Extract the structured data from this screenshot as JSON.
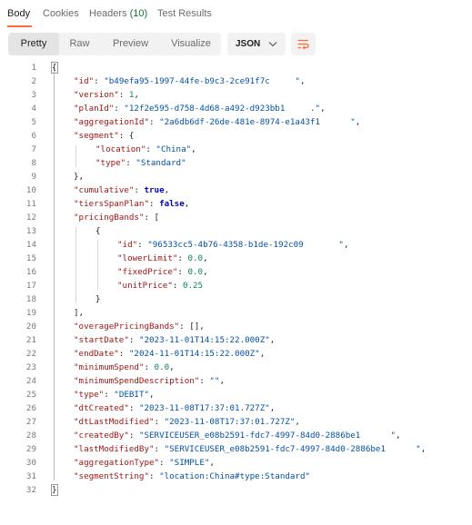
{
  "tabs": [
    {
      "label": "Body"
    },
    {
      "label": "Cookies"
    },
    {
      "label": "Headers",
      "count": "(10)"
    },
    {
      "label": "Test Results"
    }
  ],
  "view_modes": [
    "Pretty",
    "Raw",
    "Preview",
    "Visualize"
  ],
  "format": {
    "selected": "JSON"
  },
  "icons": {
    "format_caret": "chevron-down-icon",
    "wrap": "wrap-lines-icon"
  },
  "colors": {
    "accent": "#ff6c37",
    "key": "#a31515",
    "string": "#0451a5",
    "number": "#098658",
    "boolean": "#0000c2"
  },
  "lines": [
    {
      "n": "1",
      "ind": 0,
      "toks": [
        {
          "t": "{",
          "c": "p"
        }
      ]
    },
    {
      "n": "2",
      "ind": 1,
      "toks": [
        {
          "t": "\"id\"",
          "c": "k"
        },
        {
          "t": ": ",
          "c": "p"
        },
        {
          "t": "\"b49efa95-1997-44fe-b9c3-2ce91f7c     \"",
          "c": "s"
        },
        {
          "t": ",",
          "c": "p"
        }
      ]
    },
    {
      "n": "3",
      "ind": 1,
      "toks": [
        {
          "t": "\"version\"",
          "c": "k"
        },
        {
          "t": ": ",
          "c": "p"
        },
        {
          "t": "1",
          "c": "n"
        },
        {
          "t": ",",
          "c": "p"
        }
      ]
    },
    {
      "n": "4",
      "ind": 1,
      "toks": [
        {
          "t": "\"planId\"",
          "c": "k"
        },
        {
          "t": ": ",
          "c": "p"
        },
        {
          "t": "\"12f2e595-d758-4d68-a492-d923bb1     .\"",
          "c": "s"
        },
        {
          "t": ",",
          "c": "p"
        }
      ]
    },
    {
      "n": "5",
      "ind": 1,
      "toks": [
        {
          "t": "\"aggregationId\"",
          "c": "k"
        },
        {
          "t": ": ",
          "c": "p"
        },
        {
          "t": "\"2a6db6df-26de-481e-8974-e1a43f1      \"",
          "c": "s"
        },
        {
          "t": ",",
          "c": "p"
        }
      ]
    },
    {
      "n": "6",
      "ind": 1,
      "toks": [
        {
          "t": "\"segment\"",
          "c": "k"
        },
        {
          "t": ": {",
          "c": "p"
        }
      ]
    },
    {
      "n": "7",
      "ind": 2,
      "toks": [
        {
          "t": "\"location\"",
          "c": "k"
        },
        {
          "t": ": ",
          "c": "p"
        },
        {
          "t": "\"China\"",
          "c": "s"
        },
        {
          "t": ",",
          "c": "p"
        }
      ]
    },
    {
      "n": "8",
      "ind": 2,
      "toks": [
        {
          "t": "\"type\"",
          "c": "k"
        },
        {
          "t": ": ",
          "c": "p"
        },
        {
          "t": "\"Standard\"",
          "c": "s"
        }
      ]
    },
    {
      "n": "9",
      "ind": 1,
      "toks": [
        {
          "t": "},",
          "c": "p"
        }
      ]
    },
    {
      "n": "10",
      "ind": 1,
      "toks": [
        {
          "t": "\"cumulative\"",
          "c": "k"
        },
        {
          "t": ": ",
          "c": "p"
        },
        {
          "t": "true",
          "c": "b"
        },
        {
          "t": ",",
          "c": "p"
        }
      ]
    },
    {
      "n": "11",
      "ind": 1,
      "toks": [
        {
          "t": "\"tiersSpanPlan\"",
          "c": "k"
        },
        {
          "t": ": ",
          "c": "p"
        },
        {
          "t": "false",
          "c": "b"
        },
        {
          "t": ",",
          "c": "p"
        }
      ]
    },
    {
      "n": "12",
      "ind": 1,
      "toks": [
        {
          "t": "\"pricingBands\"",
          "c": "k"
        },
        {
          "t": ": [",
          "c": "p"
        }
      ]
    },
    {
      "n": "13",
      "ind": 2,
      "toks": [
        {
          "t": "{",
          "c": "p"
        }
      ]
    },
    {
      "n": "14",
      "ind": 3,
      "toks": [
        {
          "t": "\"id\"",
          "c": "k"
        },
        {
          "t": ": ",
          "c": "p"
        },
        {
          "t": "\"96533cc5-4b76-4358-b1de-192c09       \"",
          "c": "s"
        },
        {
          "t": ",",
          "c": "p"
        }
      ]
    },
    {
      "n": "15",
      "ind": 3,
      "toks": [
        {
          "t": "\"lowerLimit\"",
          "c": "k"
        },
        {
          "t": ": ",
          "c": "p"
        },
        {
          "t": "0.0",
          "c": "n"
        },
        {
          "t": ",",
          "c": "p"
        }
      ]
    },
    {
      "n": "16",
      "ind": 3,
      "toks": [
        {
          "t": "\"fixedPrice\"",
          "c": "k"
        },
        {
          "t": ": ",
          "c": "p"
        },
        {
          "t": "0.0",
          "c": "n"
        },
        {
          "t": ",",
          "c": "p"
        }
      ]
    },
    {
      "n": "17",
      "ind": 3,
      "toks": [
        {
          "t": "\"unitPrice\"",
          "c": "k"
        },
        {
          "t": ": ",
          "c": "p"
        },
        {
          "t": "0.25",
          "c": "n"
        }
      ]
    },
    {
      "n": "18",
      "ind": 2,
      "toks": [
        {
          "t": "}",
          "c": "p"
        }
      ]
    },
    {
      "n": "19",
      "ind": 1,
      "toks": [
        {
          "t": "],",
          "c": "p"
        }
      ]
    },
    {
      "n": "20",
      "ind": 1,
      "toks": [
        {
          "t": "\"overagePricingBands\"",
          "c": "k"
        },
        {
          "t": ": [],",
          "c": "p"
        }
      ]
    },
    {
      "n": "21",
      "ind": 1,
      "toks": [
        {
          "t": "\"startDate\"",
          "c": "k"
        },
        {
          "t": ": ",
          "c": "p"
        },
        {
          "t": "\"2023-11-01T14:15:22.000Z\"",
          "c": "s"
        },
        {
          "t": ",",
          "c": "p"
        }
      ]
    },
    {
      "n": "22",
      "ind": 1,
      "toks": [
        {
          "t": "\"endDate\"",
          "c": "k"
        },
        {
          "t": ": ",
          "c": "p"
        },
        {
          "t": "\"2024-11-01T14:15:22.000Z\"",
          "c": "s"
        },
        {
          "t": ",",
          "c": "p"
        }
      ]
    },
    {
      "n": "23",
      "ind": 1,
      "toks": [
        {
          "t": "\"minimumSpend\"",
          "c": "k"
        },
        {
          "t": ": ",
          "c": "p"
        },
        {
          "t": "0.0",
          "c": "n"
        },
        {
          "t": ",",
          "c": "p"
        }
      ]
    },
    {
      "n": "24",
      "ind": 1,
      "toks": [
        {
          "t": "\"minimumSpendDescription\"",
          "c": "k"
        },
        {
          "t": ": ",
          "c": "p"
        },
        {
          "t": "\"\"",
          "c": "s"
        },
        {
          "t": ",",
          "c": "p"
        }
      ]
    },
    {
      "n": "25",
      "ind": 1,
      "toks": [
        {
          "t": "\"type\"",
          "c": "k"
        },
        {
          "t": ": ",
          "c": "p"
        },
        {
          "t": "\"DEBIT\"",
          "c": "s"
        },
        {
          "t": ",",
          "c": "p"
        }
      ]
    },
    {
      "n": "26",
      "ind": 1,
      "toks": [
        {
          "t": "\"dtCreated\"",
          "c": "k"
        },
        {
          "t": ": ",
          "c": "p"
        },
        {
          "t": "\"2023-11-08T17:37:01.727Z\"",
          "c": "s"
        },
        {
          "t": ",",
          "c": "p"
        }
      ]
    },
    {
      "n": "27",
      "ind": 1,
      "toks": [
        {
          "t": "\"dtLastModified\"",
          "c": "k"
        },
        {
          "t": ": ",
          "c": "p"
        },
        {
          "t": "\"2023-11-08T17:37:01.727Z\"",
          "c": "s"
        },
        {
          "t": ",",
          "c": "p"
        }
      ]
    },
    {
      "n": "28",
      "ind": 1,
      "toks": [
        {
          "t": "\"createdBy\"",
          "c": "k"
        },
        {
          "t": ": ",
          "c": "p"
        },
        {
          "t": "\"SERVICEUSER_e08b2591-fdc7-4997-84d0-2886be1      \"",
          "c": "s"
        },
        {
          "t": ",",
          "c": "p"
        }
      ]
    },
    {
      "n": "29",
      "ind": 1,
      "toks": [
        {
          "t": "\"lastModifiedBy\"",
          "c": "k"
        },
        {
          "t": ": ",
          "c": "p"
        },
        {
          "t": "\"SERVICEUSER_e08b2591-fdc7-4997-84d0-2886be1      \"",
          "c": "s"
        },
        {
          "t": ",",
          "c": "p"
        }
      ]
    },
    {
      "n": "30",
      "ind": 1,
      "toks": [
        {
          "t": "\"aggregationType\"",
          "c": "k"
        },
        {
          "t": ": ",
          "c": "p"
        },
        {
          "t": "\"SIMPLE\"",
          "c": "s"
        },
        {
          "t": ",",
          "c": "p"
        }
      ]
    },
    {
      "n": "31",
      "ind": 1,
      "toks": [
        {
          "t": "\"segmentString\"",
          "c": "k"
        },
        {
          "t": ": ",
          "c": "p"
        },
        {
          "t": "\"location:China#type:Standard\"",
          "c": "s"
        }
      ]
    },
    {
      "n": "32",
      "ind": 0,
      "toks": [
        {
          "t": "}",
          "c": "p"
        }
      ]
    }
  ]
}
